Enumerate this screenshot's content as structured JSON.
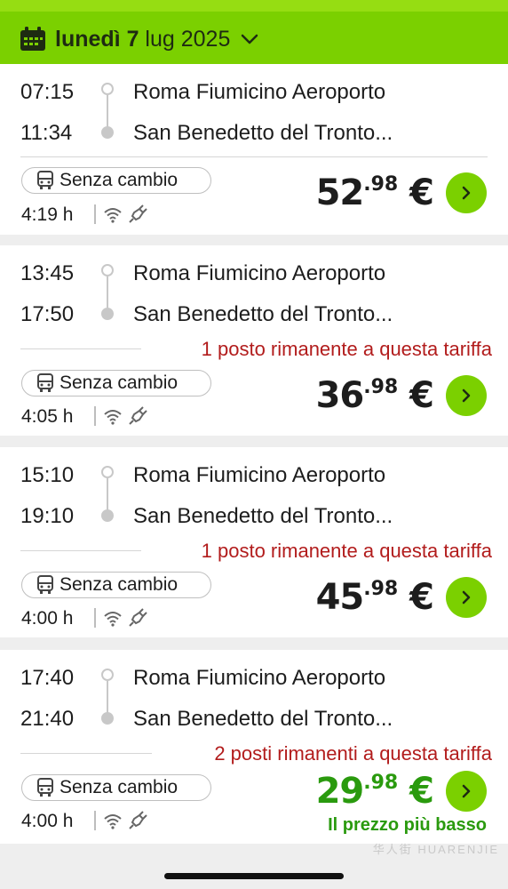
{
  "header": {
    "day": "lunedì",
    "date_num": "7",
    "month_year": "lug 2025",
    "calendar_icon": "calendar-icon",
    "dropdown_icon": "chevron-down-icon"
  },
  "trips": [
    {
      "departure_time": "07:15",
      "arrival_time": "11:34",
      "origin": "Roma Fiumicino Aeroporto",
      "destination": "San Benedetto del Tronto...",
      "availability": "",
      "transfer": "Senza cambio",
      "duration": "4:19 h",
      "price_main": "52",
      "price_cents": ".98",
      "currency": "€",
      "badge": ""
    },
    {
      "departure_time": "13:45",
      "arrival_time": "17:50",
      "origin": "Roma Fiumicino Aeroporto",
      "destination": "San Benedetto del Tronto...",
      "availability": "1 posto rimanente a questa tariffa",
      "transfer": "Senza cambio",
      "duration": "4:05 h",
      "price_main": "36",
      "price_cents": ".98",
      "currency": "€",
      "badge": ""
    },
    {
      "departure_time": "15:10",
      "arrival_time": "19:10",
      "origin": "Roma Fiumicino Aeroporto",
      "destination": "San Benedetto del Tronto...",
      "availability": "1 posto rimanente a questa tariffa",
      "transfer": "Senza cambio",
      "duration": "4:00 h",
      "price_main": "45",
      "price_cents": ".98",
      "currency": "€",
      "badge": ""
    },
    {
      "departure_time": "17:40",
      "arrival_time": "21:40",
      "origin": "Roma Fiumicino Aeroporto",
      "destination": "San Benedetto del Tronto...",
      "availability": "2 posti rimanenti a questa tariffa",
      "transfer": "Senza cambio",
      "duration": "4:00 h",
      "price_main": "29",
      "price_cents": ".98",
      "currency": "€",
      "badge": "Il prezzo più basso"
    }
  ],
  "icons": {
    "bus": "bus-icon",
    "wifi": "wifi-icon",
    "power": "power-plug-icon",
    "go": "chevron-right-icon"
  },
  "colors": {
    "brand_green": "#7bd000",
    "price_green": "#2a9a0e",
    "alert_red": "#b21c1c"
  },
  "watermark": "华人街 HUARENJIE"
}
